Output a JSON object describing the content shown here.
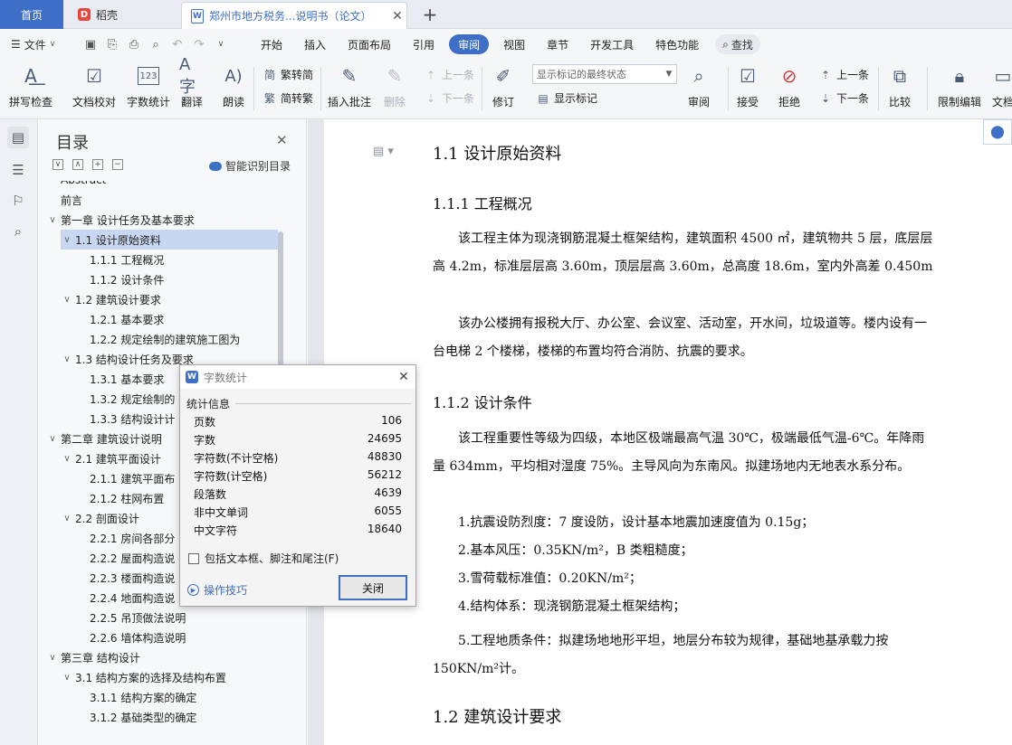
{
  "tabs": {
    "home": "首页",
    "daoke": "稻壳",
    "doc_title": "郑州市地方税务...说明书（论文）"
  },
  "menu": {
    "file": "文件",
    "items": [
      "开始",
      "插入",
      "页面布局",
      "引用",
      "审阅",
      "视图",
      "章节",
      "开发工具",
      "特色功能"
    ],
    "active": "审阅",
    "search": "查找"
  },
  "ribbon": {
    "spell_check": "拼写检查",
    "doc_proof": "文档校对",
    "word_count": "字数统计",
    "translate": "翻译",
    "read_aloud": "朗读",
    "trad_to_simp": "繁转简",
    "simp_to_trad": "简转繁",
    "insert_comment": "插入批注",
    "delete": "删除",
    "prev_comment": "上一条",
    "next_comment": "下一条",
    "revise": "修订",
    "markup_state": "显示标记的最终状态",
    "show_markup": "显示标记",
    "review": "审阅",
    "accept": "接受",
    "reject": "拒绝",
    "prev_change": "上一条",
    "next_change": "下一条",
    "compare": "比较",
    "restrict_edit": "限制编辑",
    "doc_cut": "文档"
  },
  "toc": {
    "title": "目录",
    "smart": "智能识别目录",
    "items": [
      {
        "label": "Abstract",
        "level": 1,
        "chev": ""
      },
      {
        "label": "前言",
        "level": 1,
        "chev": ""
      },
      {
        "label": "第一章  设计任务及基本要求",
        "level": 1,
        "chev": "∨"
      },
      {
        "label": "1.1  设计原始资料",
        "level": 2,
        "chev": "∨"
      },
      {
        "label": "1.1.1  工程概况",
        "level": 3,
        "chev": ""
      },
      {
        "label": "1.1.2  设计条件",
        "level": 3,
        "chev": ""
      },
      {
        "label": "1.2  建筑设计要求",
        "level": 2,
        "chev": "∨"
      },
      {
        "label": "1.2.1 基本要求",
        "level": 3,
        "chev": ""
      },
      {
        "label": "1.2.2 规定绘制的建筑施工图为",
        "level": 3,
        "chev": ""
      },
      {
        "label": "1.3 结构设计任务及要求",
        "level": 2,
        "chev": "∨"
      },
      {
        "label": "1.3.1 基本要求",
        "level": 3,
        "chev": ""
      },
      {
        "label": "1.3.2 规定绘制的",
        "level": 3,
        "chev": ""
      },
      {
        "label": "1.3.3 结构设计计",
        "level": 3,
        "chev": ""
      },
      {
        "label": "第二章  建筑设计说明",
        "level": 1,
        "chev": "∨"
      },
      {
        "label": "2.1 建筑平面设计",
        "level": 2,
        "chev": "∨"
      },
      {
        "label": "2.1.1 建筑平面布",
        "level": 3,
        "chev": ""
      },
      {
        "label": "2.1.2 柱网布置",
        "level": 3,
        "chev": ""
      },
      {
        "label": "2.2 剖面设计",
        "level": 2,
        "chev": "∨"
      },
      {
        "label": "2.2.1 房间各部分",
        "level": 3,
        "chev": ""
      },
      {
        "label": "2.2.2 屋面构造说",
        "level": 3,
        "chev": ""
      },
      {
        "label": "2.2.3 楼面构造说",
        "level": 3,
        "chev": ""
      },
      {
        "label": "2.2.4 地面构造说",
        "level": 3,
        "chev": ""
      },
      {
        "label": "2.2.5 吊顶做法说明",
        "level": 3,
        "chev": ""
      },
      {
        "label": "2.2.6 墙体构造说明",
        "level": 3,
        "chev": ""
      },
      {
        "label": "第三章  结构设计",
        "level": 1,
        "chev": "∨"
      },
      {
        "label": "3.1  结构方案的选择及结构布置",
        "level": 2,
        "chev": "∨"
      },
      {
        "label": "3.1.1  结构方案的确定",
        "level": 3,
        "chev": ""
      },
      {
        "label": "3.1.2  基础类型的确定",
        "level": 3,
        "chev": ""
      }
    ]
  },
  "document": {
    "h_1_1": "1.1  设计原始资料",
    "h_1_1_1": "1.1.1  工程概况",
    "p1": "该工程主体为现浇钢筋混凝土框架结构，建筑面积 4500 ㎡，建筑物共 5 层，底层层高 4.2m，标准层层高 3.60m，顶层层高 3.60m，总高度 18.6m，室内外高差 0.450m",
    "p2": "该办公楼拥有报税大厅、办公室、会议室、活动室，开水间，垃圾道等。楼内设有一台电梯 2 个楼梯，楼梯的布置均符合消防、抗震的要求。",
    "h_1_1_2": "1.1.2  设计条件",
    "p3": "该工程重要性等级为四级，本地区极端最高气温 30℃，极端最低气温-6℃。年降雨量 634mm，平均相对湿度 75%。主导风向为东南风。拟建场地内无地表水系分布。",
    "p4": "1.抗震设防烈度：7 度设防，设计基本地震加速度值为 0.15g；",
    "p5": "2.基本风压：0.35KN/m²，B 类粗糙度；",
    "p6": "3.雪荷载标准值：0.20KN/m²；",
    "p7": "4.结构体系：现浇钢筋混凝土框架结构；",
    "p8": "5.工程地质条件：拟建场地地形平坦，地层分布较为规律，基础地基承载力按 150KN/m²计。",
    "h_1_2": "1.2  建筑设计要求"
  },
  "dialog": {
    "title": "字数统计",
    "section": "统计信息",
    "stats": [
      {
        "label": "页数",
        "value": "106"
      },
      {
        "label": "字数",
        "value": "24695"
      },
      {
        "label": "字符数(不计空格)",
        "value": "48830"
      },
      {
        "label": "字符数(计空格)",
        "value": "56212"
      },
      {
        "label": "段落数",
        "value": "4639"
      },
      {
        "label": "非中文单词",
        "value": "6055"
      },
      {
        "label": "中文字符",
        "value": "18640"
      }
    ],
    "checkbox": "包括文本框、脚注和尾注(F)",
    "tips": "操作技巧",
    "close": "关闭"
  }
}
